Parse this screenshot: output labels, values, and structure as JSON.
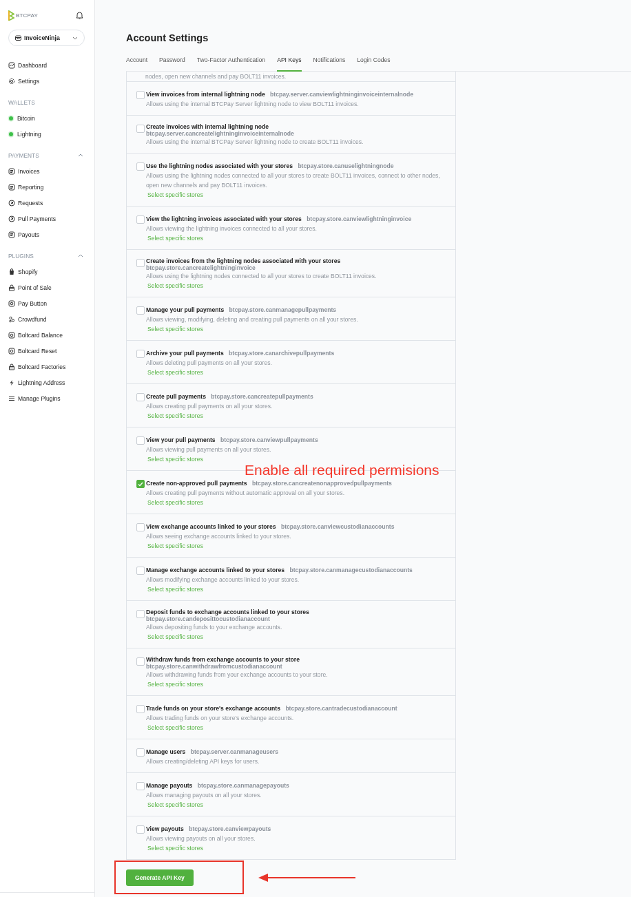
{
  "sidebar": {
    "logo": "BTCPAY",
    "store_selector": "InvoiceNinja",
    "top_items": [
      {
        "label": "Dashboard"
      },
      {
        "label": "Settings"
      }
    ],
    "sections": [
      {
        "heading": "WALLETS",
        "items": [
          {
            "label": "Bitcoin",
            "color": "#3ec14a"
          },
          {
            "label": "Lightning",
            "color": "#3ec14a"
          }
        ]
      },
      {
        "heading": "PAYMENTS",
        "expanded": true,
        "items": [
          {
            "label": "Invoices"
          },
          {
            "label": "Reporting"
          },
          {
            "label": "Requests"
          },
          {
            "label": "Pull Payments"
          },
          {
            "label": "Payouts"
          }
        ]
      },
      {
        "heading": "PLUGINS",
        "expanded": true,
        "items": [
          {
            "label": "Shopify"
          },
          {
            "label": "Point of Sale"
          },
          {
            "label": "Pay Button"
          },
          {
            "label": "Crowdfund"
          },
          {
            "label": "Boltcard Balance"
          },
          {
            "label": "Boltcard Reset"
          },
          {
            "label": "Boltcard Factories"
          },
          {
            "label": "Lightning Address"
          },
          {
            "label": "Manage Plugins"
          }
        ]
      }
    ]
  },
  "page_title": "Account Settings",
  "tabs": [
    {
      "label": "Account",
      "selected": false
    },
    {
      "label": "Password",
      "selected": false
    },
    {
      "label": "Two-Factor Authentication",
      "selected": false
    },
    {
      "label": "API Keys",
      "selected": true
    },
    {
      "label": "Notifications",
      "selected": false
    },
    {
      "label": "Login Codes",
      "selected": false
    }
  ],
  "permissions": [
    {
      "kind": "continuation",
      "description": "nodes, open new channels and pay BOLT11 invoices."
    },
    {
      "kind": "inline",
      "checked": false,
      "title": "View invoices from internal lightning node",
      "code": "btcpay.server.canviewlightninginvoiceinternalnode",
      "description": "Allows using the internal BTCPay Server lightning node to view BOLT11 invoices."
    },
    {
      "kind": "stacked",
      "checked": false,
      "title": "Create invoices with internal lightning node",
      "code": "btcpay.server.cancreatelightninginvoiceinternalnode",
      "description": "Allows using the internal BTCPay Server lightning node to create BOLT11 invoices."
    },
    {
      "kind": "inline",
      "checked": false,
      "title": "Use the lightning nodes associated with your stores",
      "code": "btcpay.store.canuselightningnode",
      "description": "Allows using the lightning nodes connected to all your stores to create BOLT11 invoices, connect to other nodes, open new channels and pay BOLT11 invoices.",
      "link": "Select specific stores"
    },
    {
      "kind": "inline",
      "checked": false,
      "title": "View the lightning invoices associated with your stores",
      "code": "btcpay.store.canviewlightninginvoice",
      "description": "Allows viewing the lightning invoices connected to all your stores.",
      "link": "Select specific stores"
    },
    {
      "kind": "stacked",
      "checked": false,
      "title": "Create invoices from the lightning nodes associated with your stores",
      "code": "btcpay.store.cancreatelightninginvoice",
      "description": "Allows using the lightning nodes connected to all your stores to create BOLT11 invoices.",
      "link": "Select specific stores"
    },
    {
      "kind": "inline",
      "checked": false,
      "title": "Manage your pull payments",
      "code": "btcpay.store.canmanagepullpayments",
      "description": "Allows viewing, modifying, deleting and creating pull payments on all your stores.",
      "link": "Select specific stores"
    },
    {
      "kind": "inline",
      "checked": false,
      "title": "Archive your pull payments",
      "code": "btcpay.store.canarchivepullpayments",
      "description": "Allows deleting pull payments on all your stores.",
      "link": "Select specific stores"
    },
    {
      "kind": "inline",
      "checked": false,
      "title": "Create pull payments",
      "code": "btcpay.store.cancreatepullpayments",
      "description": "Allows creating pull payments on all your stores.",
      "link": "Select specific stores"
    },
    {
      "kind": "inline",
      "checked": false,
      "title": "View your pull payments",
      "code": "btcpay.store.canviewpullpayments",
      "description": "Allows viewing pull payments on all your stores.",
      "link": "Select specific stores"
    },
    {
      "kind": "inline",
      "checked": true,
      "title": "Create non-approved pull payments",
      "code": "btcpay.store.cancreatenonapprovedpullpayments",
      "description": "Allows creating pull payments without automatic approval on all your stores.",
      "link": "Select specific stores"
    },
    {
      "kind": "inline",
      "checked": false,
      "title": "View exchange accounts linked to your stores",
      "code": "btcpay.store.canviewcustodianaccounts",
      "description": "Allows seeing exchange accounts linked to your stores.",
      "link": "Select specific stores"
    },
    {
      "kind": "inline",
      "checked": false,
      "title": "Manage exchange accounts linked to your stores",
      "code": "btcpay.store.canmanagecustodianaccounts",
      "description": "Allows modifying exchange accounts linked to your stores.",
      "link": "Select specific stores"
    },
    {
      "kind": "stacked",
      "checked": false,
      "title": "Deposit funds to exchange accounts linked to your stores",
      "code": "btcpay.store.candeposittocustodianaccount",
      "description": "Allows depositing funds to your exchange accounts.",
      "link": "Select specific stores"
    },
    {
      "kind": "stacked",
      "checked": false,
      "title": "Withdraw funds from exchange accounts to your store",
      "code": "btcpay.store.canwithdrawfromcustodianaccount",
      "description": "Allows withdrawing funds from your exchange accounts to your store.",
      "link": "Select specific stores"
    },
    {
      "kind": "inline",
      "checked": false,
      "title": "Trade funds on your store's exchange accounts",
      "code": "btcpay.store.cantradecustodianaccount",
      "description": "Allows trading funds on your store's exchange accounts.",
      "link": "Select specific stores"
    },
    {
      "kind": "inline",
      "checked": false,
      "title": "Manage users",
      "code": "btcpay.server.canmanageusers",
      "description": "Allows creating/deleting API keys for users."
    },
    {
      "kind": "inline",
      "checked": false,
      "title": "Manage payouts",
      "code": "btcpay.store.canmanagepayouts",
      "description": "Allows managing payouts on all your stores.",
      "link": "Select specific stores"
    },
    {
      "kind": "inline",
      "checked": false,
      "title": "View payouts",
      "code": "btcpay.store.canviewpayouts",
      "description": "Allows viewing payouts on all your stores.",
      "link": "Select specific stores"
    }
  ],
  "generate_button": "Generate API Key",
  "annotation": {
    "note": "Enable all required permisions"
  }
}
